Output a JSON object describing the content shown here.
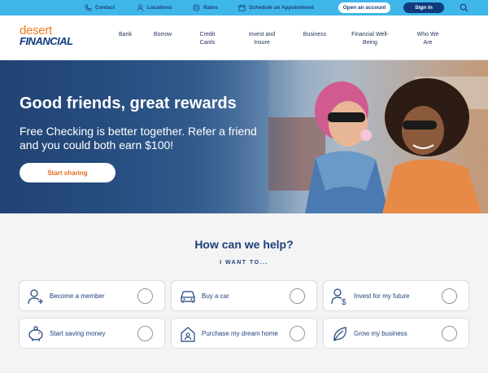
{
  "utility": {
    "contact": "Contact",
    "locations": "Locations",
    "rates": "Rates",
    "appointment": "Schedule an Appointment",
    "open_account": "Open an account",
    "sign_in": "Sign in"
  },
  "logo": {
    "line1": "desert",
    "line2": "FINANCIAL"
  },
  "nav": {
    "items": [
      "Bank",
      "Borrow",
      "Credit\nCards",
      "Invest and\nInsure",
      "Business",
      "Financial Well-\nBeing",
      "Who We\nAre"
    ]
  },
  "hero": {
    "title": "Good friends, great rewards",
    "subtitle": "Free Checking is better together. Refer a friend and you could both earn $100!",
    "button": "Start sharing"
  },
  "help": {
    "title": "How can we help?",
    "kicker": "I WANT TO...",
    "cards": [
      {
        "label": "Become a member",
        "icon": "person-add-icon"
      },
      {
        "label": "Buy a car",
        "icon": "car-icon"
      },
      {
        "label": "Invest for my future",
        "icon": "person-dollar-icon"
      },
      {
        "label": "Start saving money",
        "icon": "piggy-bank-icon"
      },
      {
        "label": "Purchase my dream home",
        "icon": "home-icon"
      },
      {
        "label": "Grow my business",
        "icon": "leaf-icon"
      }
    ]
  },
  "colors": {
    "utility_bar": "#3fb6ea",
    "navy": "#1c3f7a",
    "orange": "#e26d1d",
    "section_bg": "#f4f4f4"
  }
}
